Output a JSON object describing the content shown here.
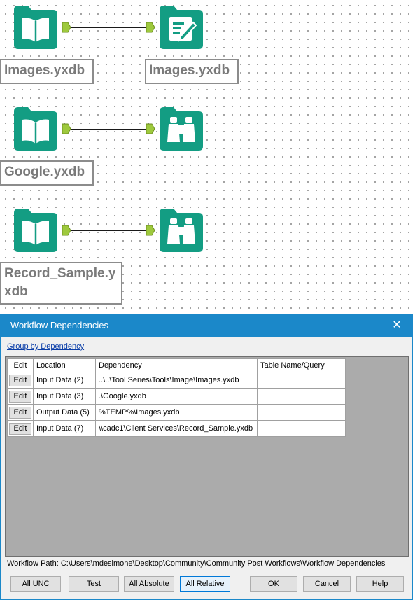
{
  "canvas": {
    "labels": [
      "Images.yxdb",
      "Images.yxdb",
      "Google.yxdb",
      "Record_Sample.y xdb"
    ],
    "icons": [
      "input-data-book-icon",
      "output-data-document-icon",
      "browse-binoculars-icon"
    ]
  },
  "colors": {
    "tool_teal": "#139d83",
    "anchor_green": "#9ec93d",
    "dialog_blue": "#1b88c9",
    "grid_grey": "#ababab"
  },
  "dialog": {
    "title": "Workflow Dependencies",
    "close_glyph": "✕",
    "group_link": "Group by Dependency",
    "columns": [
      "Edit",
      "Location",
      "Dependency",
      "Table Name/Query"
    ],
    "rows": [
      {
        "edit": "Edit",
        "location": "Input Data (2)",
        "dependency": "..\\..\\Tool Series\\Tools\\Image\\Images.yxdb",
        "table": ""
      },
      {
        "edit": "Edit",
        "location": "Input Data (3)",
        "dependency": ".\\Google.yxdb",
        "table": ""
      },
      {
        "edit": "Edit",
        "location": "Output Data (5)",
        "dependency": "%TEMP%\\Images.yxdb",
        "table": ""
      },
      {
        "edit": "Edit",
        "location": "Input Data (7)",
        "dependency": "\\\\cadc1\\Client Services\\Record_Sample.yxdb",
        "table": ""
      }
    ],
    "workflow_path": "Workflow Path: C:\\Users\\mdesimone\\Desktop\\Community\\Community Post Workflows\\Workflow Dependencies",
    "buttons": {
      "all_unc": "All UNC",
      "test": "Test",
      "all_absolute": "All Absolute",
      "all_relative": "All Relative",
      "ok": "OK",
      "cancel": "Cancel",
      "help": "Help"
    }
  }
}
